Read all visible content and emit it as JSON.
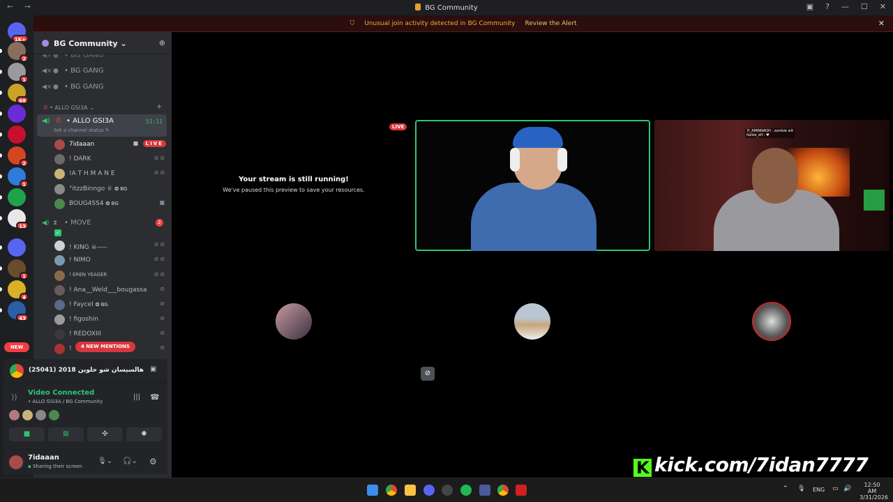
{
  "window": {
    "title": "BG Community",
    "nav": "← →"
  },
  "alert": {
    "text": "Unusual join activity detected in BG Community",
    "link": "Review the Alert"
  },
  "guilds": [
    {
      "badge": "1K+",
      "color": "#5865f2"
    },
    {
      "badge": "2",
      "color": "#8a6e5d"
    },
    {
      "badge": "1",
      "color": "#9a9a9a"
    },
    {
      "badge": "68",
      "color": "#c9a227"
    },
    {
      "badge": "",
      "color": "#6b2bd6"
    },
    {
      "badge": "",
      "color": "#c8102e"
    },
    {
      "badge": "2",
      "color": "#d4461f"
    },
    {
      "badge": "1",
      "color": "#2f7bd9"
    },
    {
      "badge": "",
      "color": "#1fa34a"
    },
    {
      "badge": "13",
      "color": "#e8e8e8"
    },
    {
      "badge": "",
      "color": "#5865f2"
    },
    {
      "badge": "1",
      "color": "#6a4c2a"
    },
    {
      "badge": "4",
      "color": "#d9b126"
    },
    {
      "badge": "43",
      "color": "#2c5ea8"
    }
  ],
  "new_pill": "NEW",
  "server": {
    "name": "BG Community"
  },
  "channels_top": [
    "• BG GANG",
    "• BG GANG",
    "• BG GANG"
  ],
  "category": "• ALLO GSI3A",
  "active_channel": {
    "name": "• ALLO GSI3A",
    "timer": "51:11",
    "status": "Set a channel status"
  },
  "members_a": [
    {
      "name": "7idaaan",
      "color": "#a84b4b",
      "live": "LIVE"
    },
    {
      "name": "! DARK",
      "color": "#6a6a6a"
    },
    {
      "name": "!A T H M A N E",
      "color": "#c9b27a"
    },
    {
      "name": "°itzzBinngo ♕",
      "color": "#8a8a8a",
      "tag": "BG"
    },
    {
      "name": "BOUG4SS4",
      "color": "#4a8a4a",
      "tag": "BG"
    }
  ],
  "move_channel": {
    "name": "• MOVE",
    "badge": "2"
  },
  "members_b": [
    {
      "name": "! KING ☠⸺",
      "color": "#d0d0d0"
    },
    {
      "name": "! NIMO",
      "color": "#7a9ab0"
    },
    {
      "name": "! EREN YEAGER",
      "color": "#8a6a4a"
    },
    {
      "name": "! Ana__Weld___bougassa",
      "color": "#6a5a5a"
    },
    {
      "name": "! Faycel",
      "color": "#5a6a8a",
      "tag": "BG"
    },
    {
      "name": "! figoshin",
      "color": "#9a9a9a"
    },
    {
      "name": "! REDOXIII",
      "color": "#3a3a3a"
    },
    {
      "name": "!",
      "color": "#aa3333"
    }
  ],
  "mentions_pill": "4 NEW MENTIONS",
  "activity": {
    "text": "(25041) 2018 أعدية هالسيسان شو حلوين ..."
  },
  "voice": {
    "status": "Video Connected",
    "location": "• ALLO GSI3A / BG Community"
  },
  "user": {
    "name": "7idaaan",
    "status": "Sharing their screen"
  },
  "stream_paused": {
    "title": "Your stream is still running!",
    "subtitle": "We've paused this preview to save your resources."
  },
  "live_badge": "LIVE",
  "overlay_chat": [
    "7I_AMINNAOH : zombie w9",
    "fazlos_elf : ♥"
  ],
  "tiles": [
    {
      "name": "tile-pink",
      "color": "#b07a80"
    },
    {
      "name": "tile-beige",
      "color": "#dcd8bd"
    },
    {
      "name": "tile-dark",
      "color": "#2a2a2a"
    }
  ],
  "kick": {
    "k": "K",
    "url": "kick.com/7idan7777"
  },
  "taskbar": {
    "lang": "ENG",
    "time": "12:50 AM",
    "date": "3/31/2026"
  }
}
